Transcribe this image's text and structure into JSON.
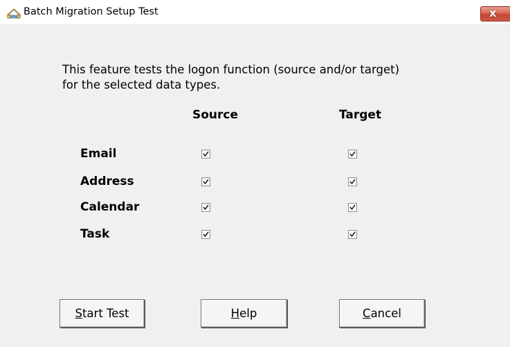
{
  "window": {
    "title": "Batch Migration Setup Test",
    "close_label": "x"
  },
  "intro": {
    "line1": "This feature tests the logon function (source and/or target)",
    "line2": "for the selected data types."
  },
  "columns": {
    "source": "Source",
    "target": "Target"
  },
  "rows": [
    {
      "label": "Email",
      "source_checked": true,
      "target_checked": true
    },
    {
      "label": "Address",
      "source_checked": true,
      "target_checked": true
    },
    {
      "label": "Calendar",
      "source_checked": true,
      "target_checked": true
    },
    {
      "label": "Task",
      "source_checked": true,
      "target_checked": true
    }
  ],
  "buttons": {
    "start_test": {
      "mnemonic": "S",
      "rest": "tart Test"
    },
    "help": {
      "mnemonic": "H",
      "rest": "elp"
    },
    "cancel": {
      "mnemonic": "C",
      "rest": "ancel"
    }
  }
}
